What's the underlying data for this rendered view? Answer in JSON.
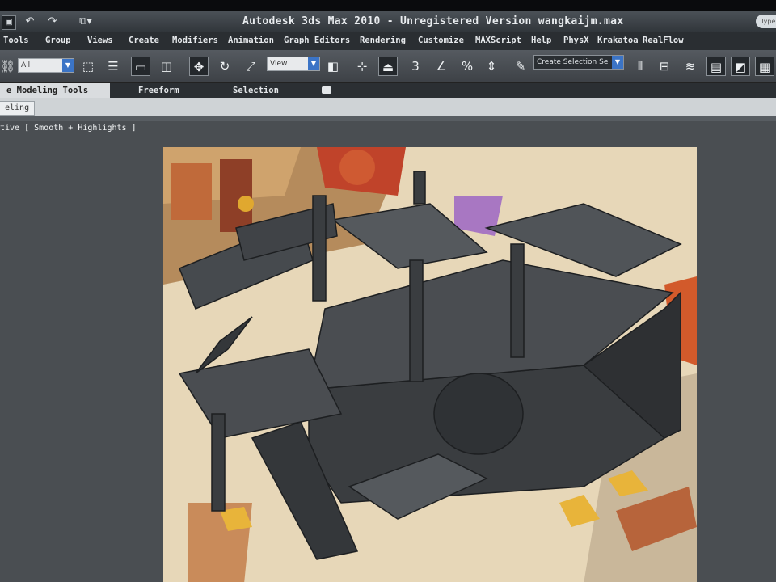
{
  "window": {
    "title": "Autodesk 3ds Max  2010  - Unregistered Version  wangkaijm.max",
    "help_search_placeholder": "Type"
  },
  "quick_access": {
    "undo_icon": "undo-icon",
    "redo_icon": "redo-icon",
    "project_icon": "project-folder-icon"
  },
  "menu": {
    "items": [
      "Tools",
      "Group",
      "Views",
      "Create",
      "Modifiers",
      "Animation",
      "Graph Editors",
      "Rendering",
      "Customize",
      "MAXScript",
      "Help",
      "PhysX",
      "Krakatoa",
      "RealFlow"
    ]
  },
  "toolbar": {
    "selection_filter": "All",
    "reference_coord": "View",
    "snap_label": "3",
    "percent_label": "%",
    "named_selection_placeholder": "Create Selection Se"
  },
  "ribbon": {
    "tabs": [
      "Graphite Modeling Tools",
      "Freeform",
      "Selection"
    ],
    "active_tab_visible": "e Modeling Tools",
    "subtab": "eling"
  },
  "viewport": {
    "label": "tive [ Smooth + Highlights ]",
    "background": "#4a4e52"
  },
  "colors": {
    "accent": "#3b74c6",
    "model_gray": "#3a3d40"
  }
}
